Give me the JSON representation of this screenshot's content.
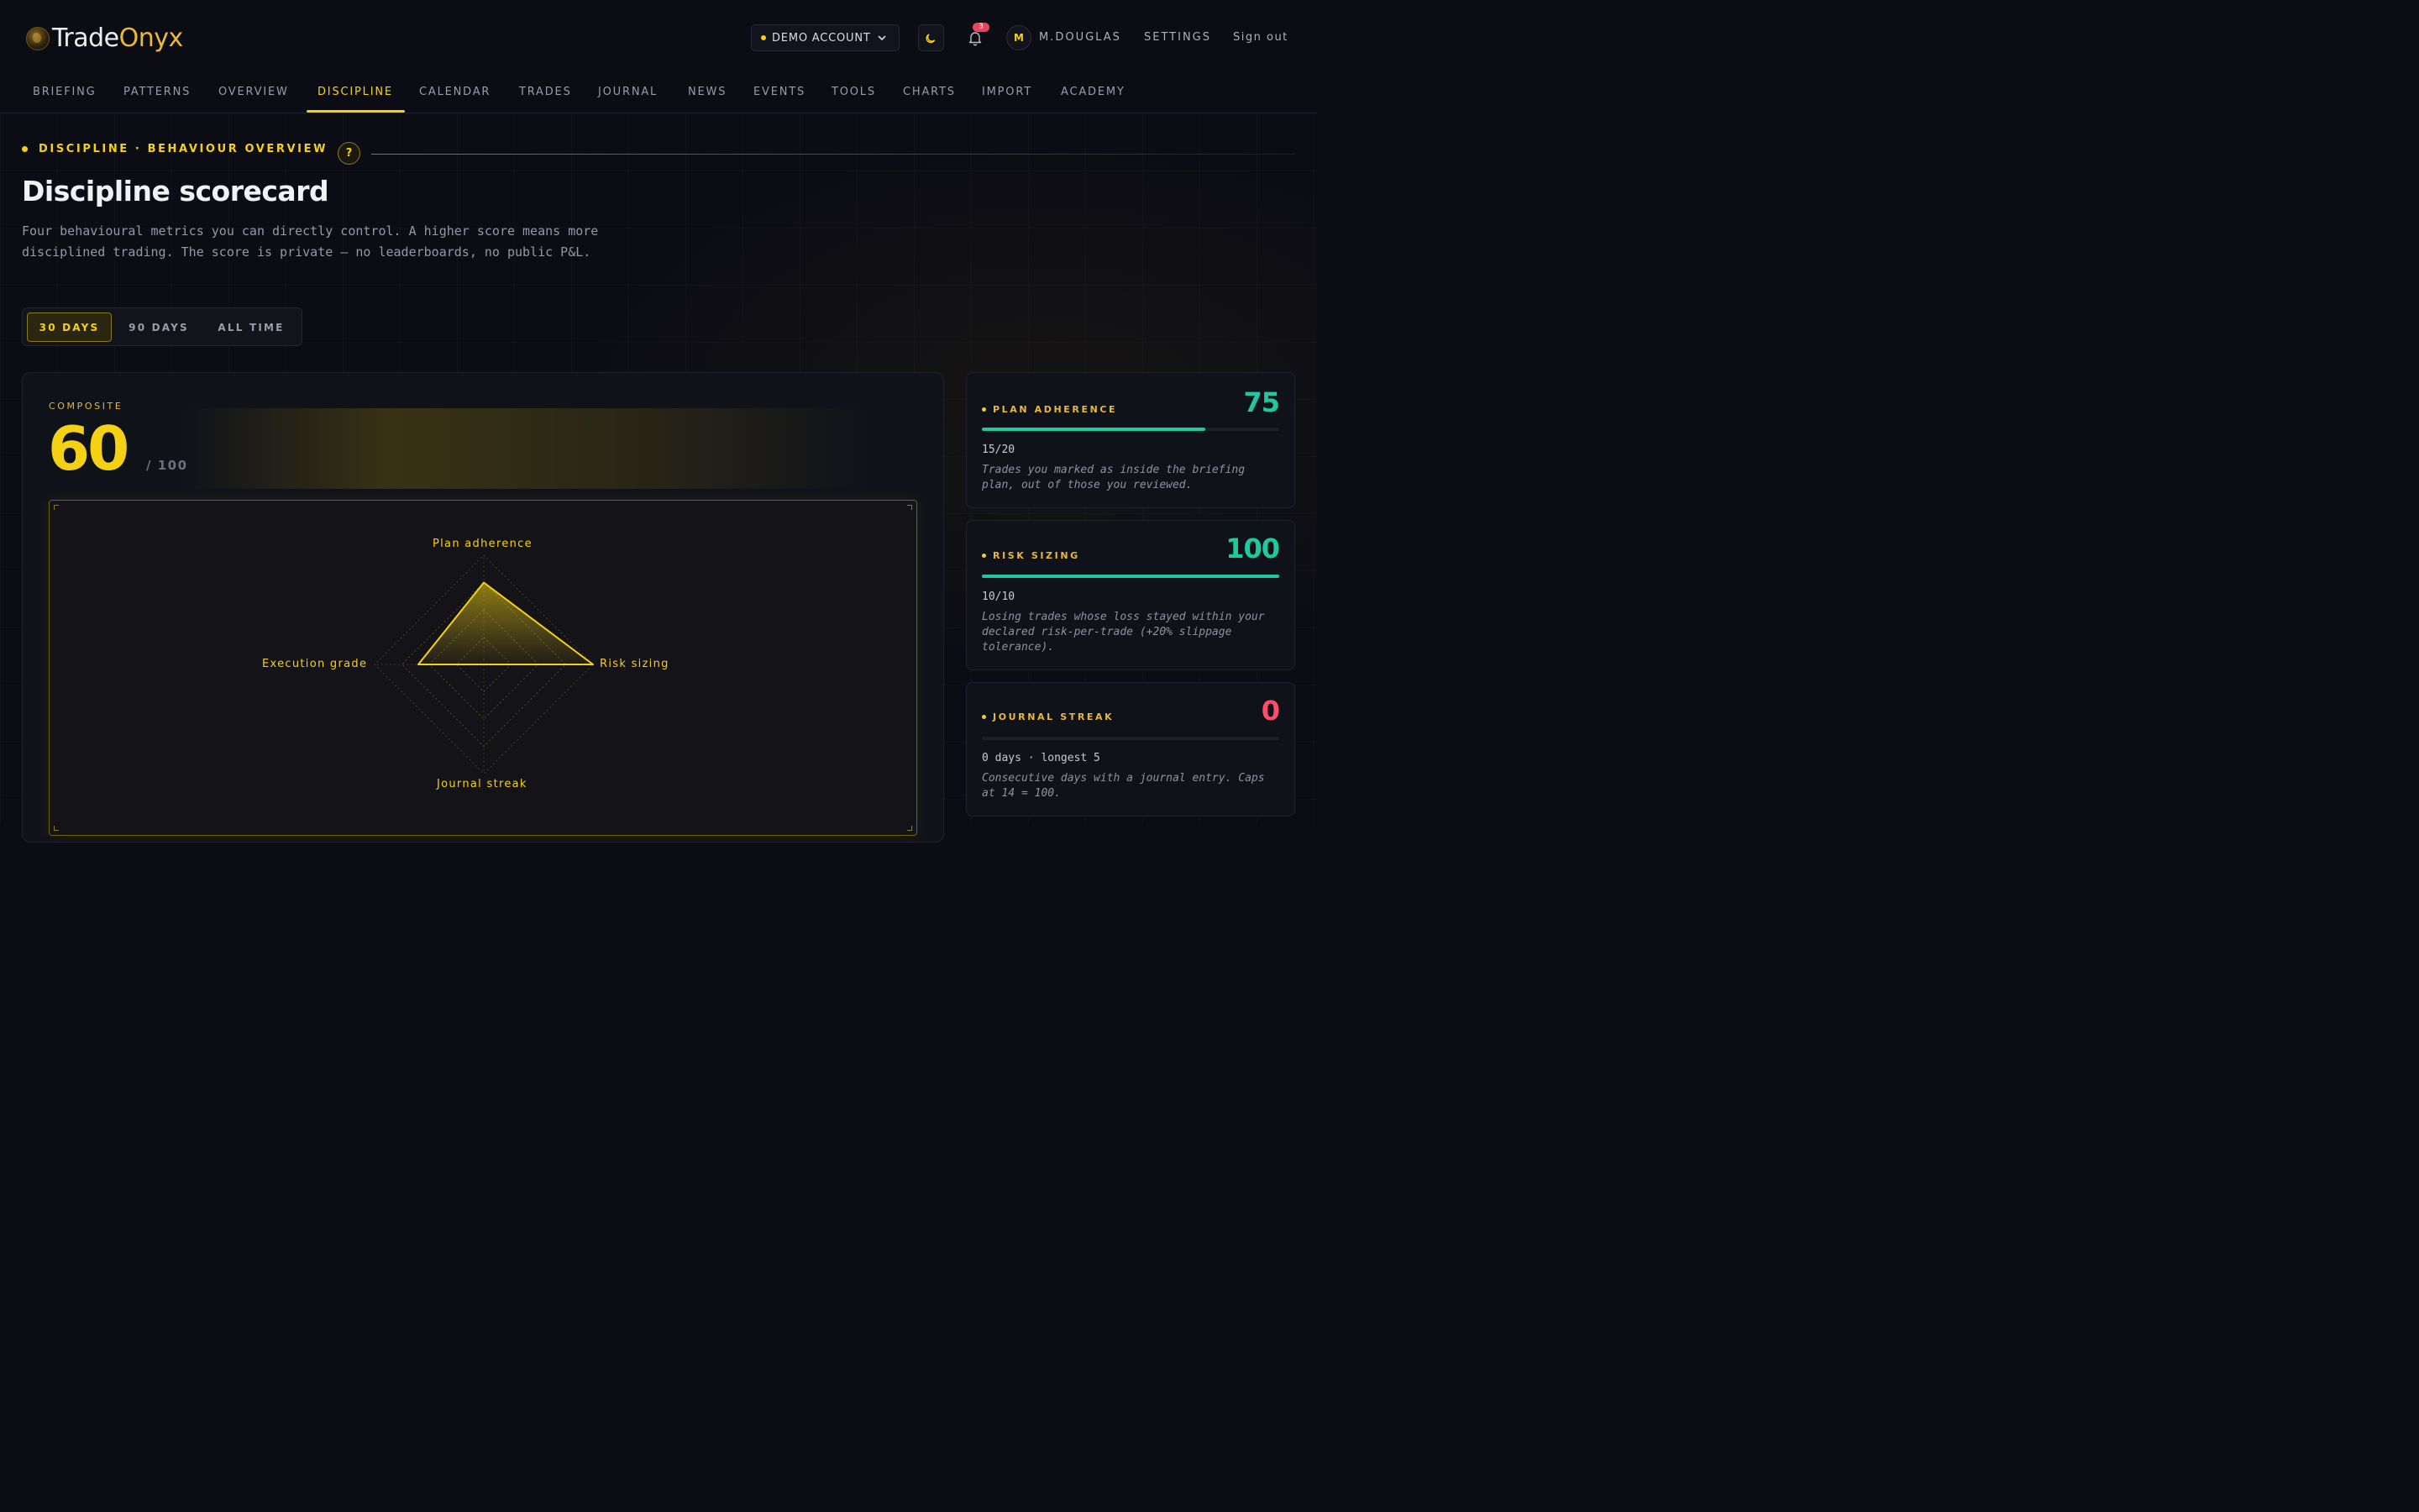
{
  "brand": {
    "part1": "Trade",
    "part2": "Onyx"
  },
  "header": {
    "account_label": "DEMO ACCOUNT",
    "notifications_count": "3",
    "avatar_initial": "M",
    "username": "M.DOUGLAS",
    "settings": "SETTINGS",
    "signout": "Sign out"
  },
  "nav": {
    "items": [
      "BRIEFING",
      "PATTERNS",
      "OVERVIEW",
      "DISCIPLINE",
      "CALENDAR",
      "TRADES",
      "JOURNAL",
      "NEWS",
      "EVENTS",
      "TOOLS",
      "CHARTS",
      "IMPORT",
      "ACADEMY"
    ],
    "active": "DISCIPLINE"
  },
  "hero": {
    "eyebrow": "DISCIPLINE · BEHAVIOUR OVERVIEW",
    "help": "?",
    "title": "Discipline scorecard",
    "description": "Four behavioural metrics you can directly control. A higher score means more disciplined trading. The score is private — no leaderboards, no public P&L."
  },
  "range": {
    "options": [
      "30 DAYS",
      "90 DAYS",
      "ALL TIME"
    ],
    "active": "30 DAYS"
  },
  "composite": {
    "label": "COMPOSITE",
    "score": "60",
    "max": "/ 100",
    "radar": {
      "axes": [
        "Plan adherence",
        "Risk sizing",
        "Journal streak",
        "Execution grade"
      ],
      "values": [
        75,
        100,
        0,
        60
      ],
      "max": 100
    }
  },
  "metrics": [
    {
      "name": "PLAN ADHERENCE",
      "value": "75",
      "progress": 0.75,
      "sub": "15/20",
      "desc": "Trades you marked as inside the briefing plan, out of those you reviewed.",
      "color": "#1fc9a0"
    },
    {
      "name": "RISK SIZING",
      "value": "100",
      "progress": 1.0,
      "sub": "10/10",
      "desc": "Losing trades whose loss stayed within your declared risk-per-trade (+20% slippage tolerance).",
      "color": "#1fc9a0"
    },
    {
      "name": "JOURNAL STREAK",
      "value": "0",
      "progress": 0,
      "sub": "0 days · longest 5",
      "desc": "Consecutive days with a journal entry. Caps at 14 = 100.",
      "color": "#ff4d6d"
    }
  ],
  "colors": {
    "accent": "#f5d116",
    "positive": "#1fc9a0",
    "negative": "#ff4d6d",
    "background": "#0b0c14"
  }
}
